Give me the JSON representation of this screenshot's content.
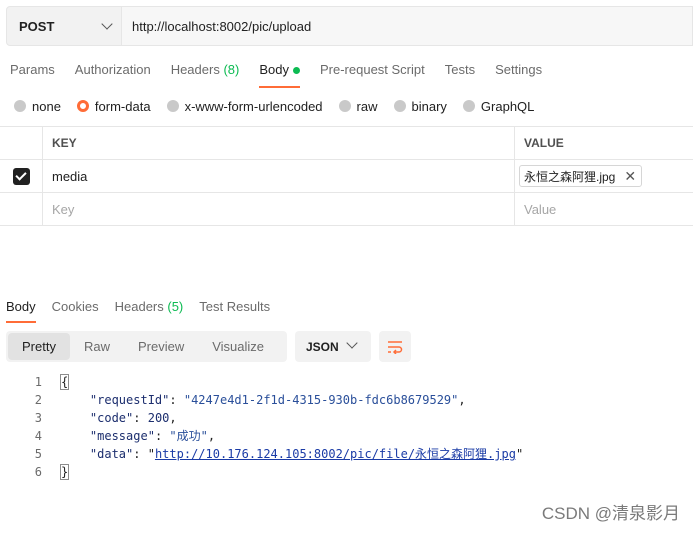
{
  "request": {
    "method": "POST",
    "url": "http://localhost:8002/pic/upload"
  },
  "request_tabs": [
    {
      "label": "Params"
    },
    {
      "label": "Authorization"
    },
    {
      "label": "Headers",
      "count": "(8)"
    },
    {
      "label": "Body",
      "active": true
    },
    {
      "label": "Pre-request Script"
    },
    {
      "label": "Tests"
    },
    {
      "label": "Settings"
    }
  ],
  "body_types": [
    {
      "label": "none",
      "selected": false
    },
    {
      "label": "form-data",
      "selected": true
    },
    {
      "label": "x-www-form-urlencoded",
      "selected": false
    },
    {
      "label": "raw",
      "selected": false
    },
    {
      "label": "binary",
      "selected": false
    },
    {
      "label": "GraphQL",
      "selected": false
    }
  ],
  "form_table": {
    "headers": {
      "key": "KEY",
      "value": "VALUE"
    },
    "rows": [
      {
        "checked": true,
        "key": "media",
        "value": "永恒之森阿狸.jpg"
      }
    ],
    "placeholder": {
      "key": "Key",
      "value": "Value"
    }
  },
  "response_tabs": [
    {
      "label": "Body",
      "active": true
    },
    {
      "label": "Cookies"
    },
    {
      "label": "Headers",
      "count": "(5)"
    },
    {
      "label": "Test Results"
    }
  ],
  "response_views": [
    "Pretty",
    "Raw",
    "Preview",
    "Visualize"
  ],
  "response_format": "JSON",
  "response_body": {
    "line_numbers": [
      "1",
      "2",
      "3",
      "4",
      "5",
      "6"
    ],
    "open": "{",
    "close": "}",
    "fields": [
      {
        "key": "\"requestId\"",
        "value": "\"4247e4d1-2f1d-4315-930b-fdc6b8679529\"",
        "kind": "string",
        "comma": ","
      },
      {
        "key": "\"code\"",
        "value": "200",
        "kind": "number",
        "comma": ","
      },
      {
        "key": "\"message\"",
        "value": "\"成功\"",
        "kind": "string",
        "comma": ","
      },
      {
        "key": "\"data\"",
        "value": "http://10.176.124.105:8002/pic/file/永恒之森阿狸.jpg",
        "kind": "link",
        "comma": ""
      }
    ]
  },
  "watermark": "CSDN @清泉影月",
  "colors": {
    "accent": "#ff6c37",
    "success": "#0cbb52"
  }
}
